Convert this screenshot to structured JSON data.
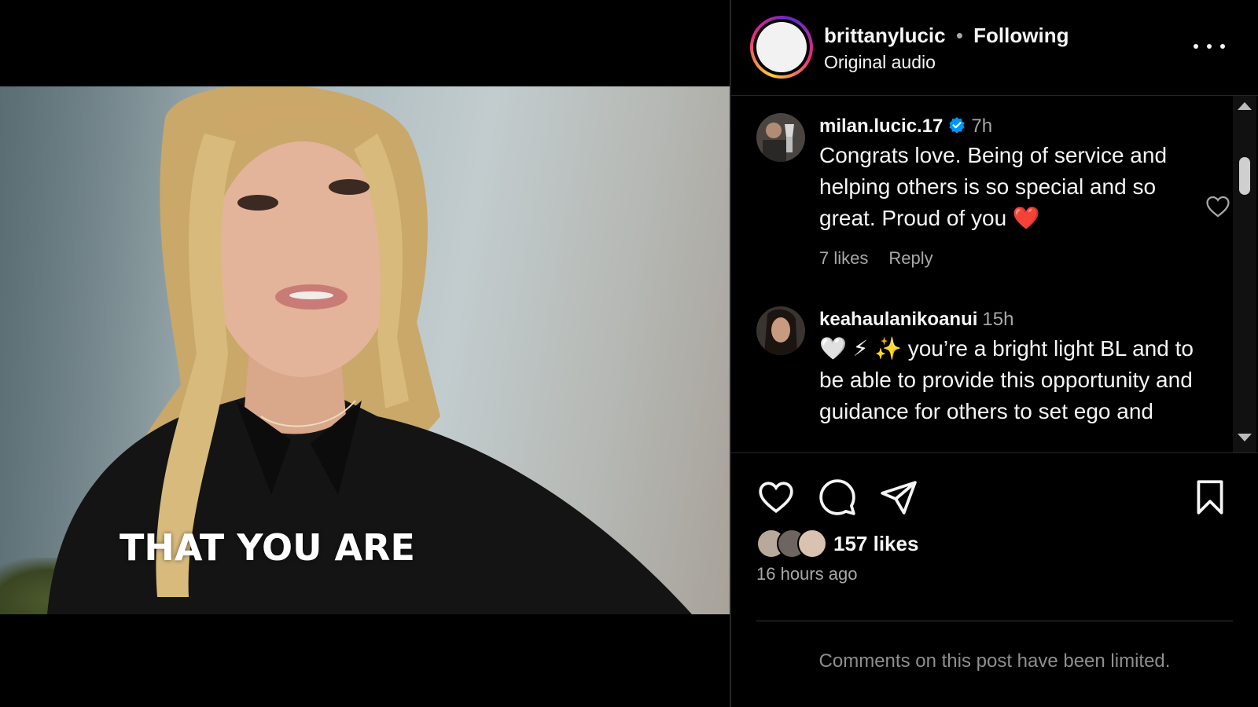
{
  "video": {
    "caption": "THAT YOU ARE",
    "mute_icon": "speaker-volume-icon"
  },
  "header": {
    "username": "brittanylucic",
    "separator": "•",
    "follow_status": "Following",
    "audio": "Original audio",
    "more_icon": "more-horizontal-icon"
  },
  "comments": [
    {
      "username": "milan.lucic.17",
      "verified": true,
      "time": "7h",
      "text": "Congrats love. Being of service and helping others is so special and so great. Proud of you ❤️",
      "likes": "7 likes",
      "reply": "Reply"
    },
    {
      "username": "keahaulanikoanui",
      "verified": false,
      "time": "15h",
      "text": "🤍 ⚡ ✨ you’re a bright light BL and to be able to provide this opportunity and guidance for others to set ego and"
    }
  ],
  "post": {
    "likes": "157 likes",
    "time_ago": "16 hours ago",
    "comments_limited": "Comments on this post have been limited."
  },
  "colors": {
    "background": "#000000",
    "text_primary": "#f5f5f5",
    "text_secondary": "#a8a8a8",
    "verified_blue": "#0095f6",
    "divider": "#262626"
  }
}
